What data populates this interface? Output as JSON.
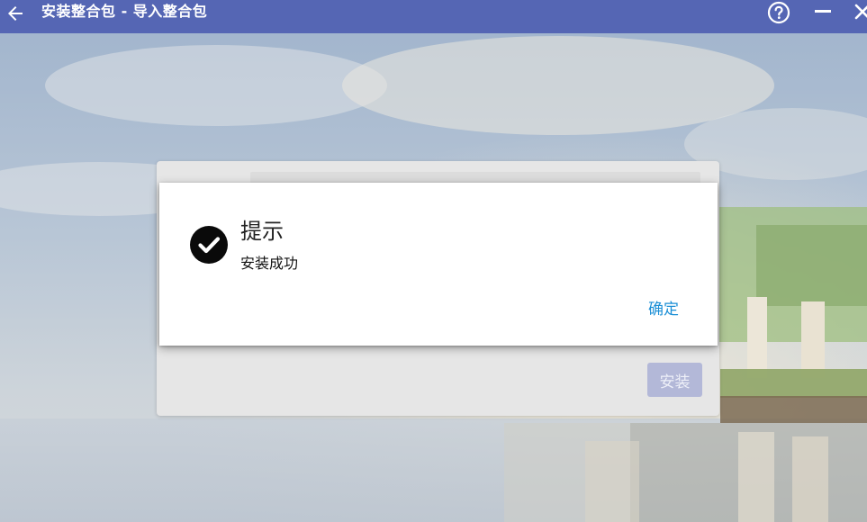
{
  "window": {
    "title": "安装整合包 - 导入整合包",
    "back_icon": "back-arrow-icon",
    "help_icon": "help-circle-icon",
    "minimize_icon": "minimize-icon",
    "close_icon": "close-icon"
  },
  "install_card": {
    "install_label": "安装"
  },
  "dialog": {
    "icon": "check-circle-icon",
    "title": "提示",
    "message": "安装成功",
    "confirm_label": "确定"
  },
  "colors": {
    "titlebar": "#5566b4",
    "accent_link": "#1b8fd6",
    "install_button_disabled": "#b3b8d8"
  }
}
